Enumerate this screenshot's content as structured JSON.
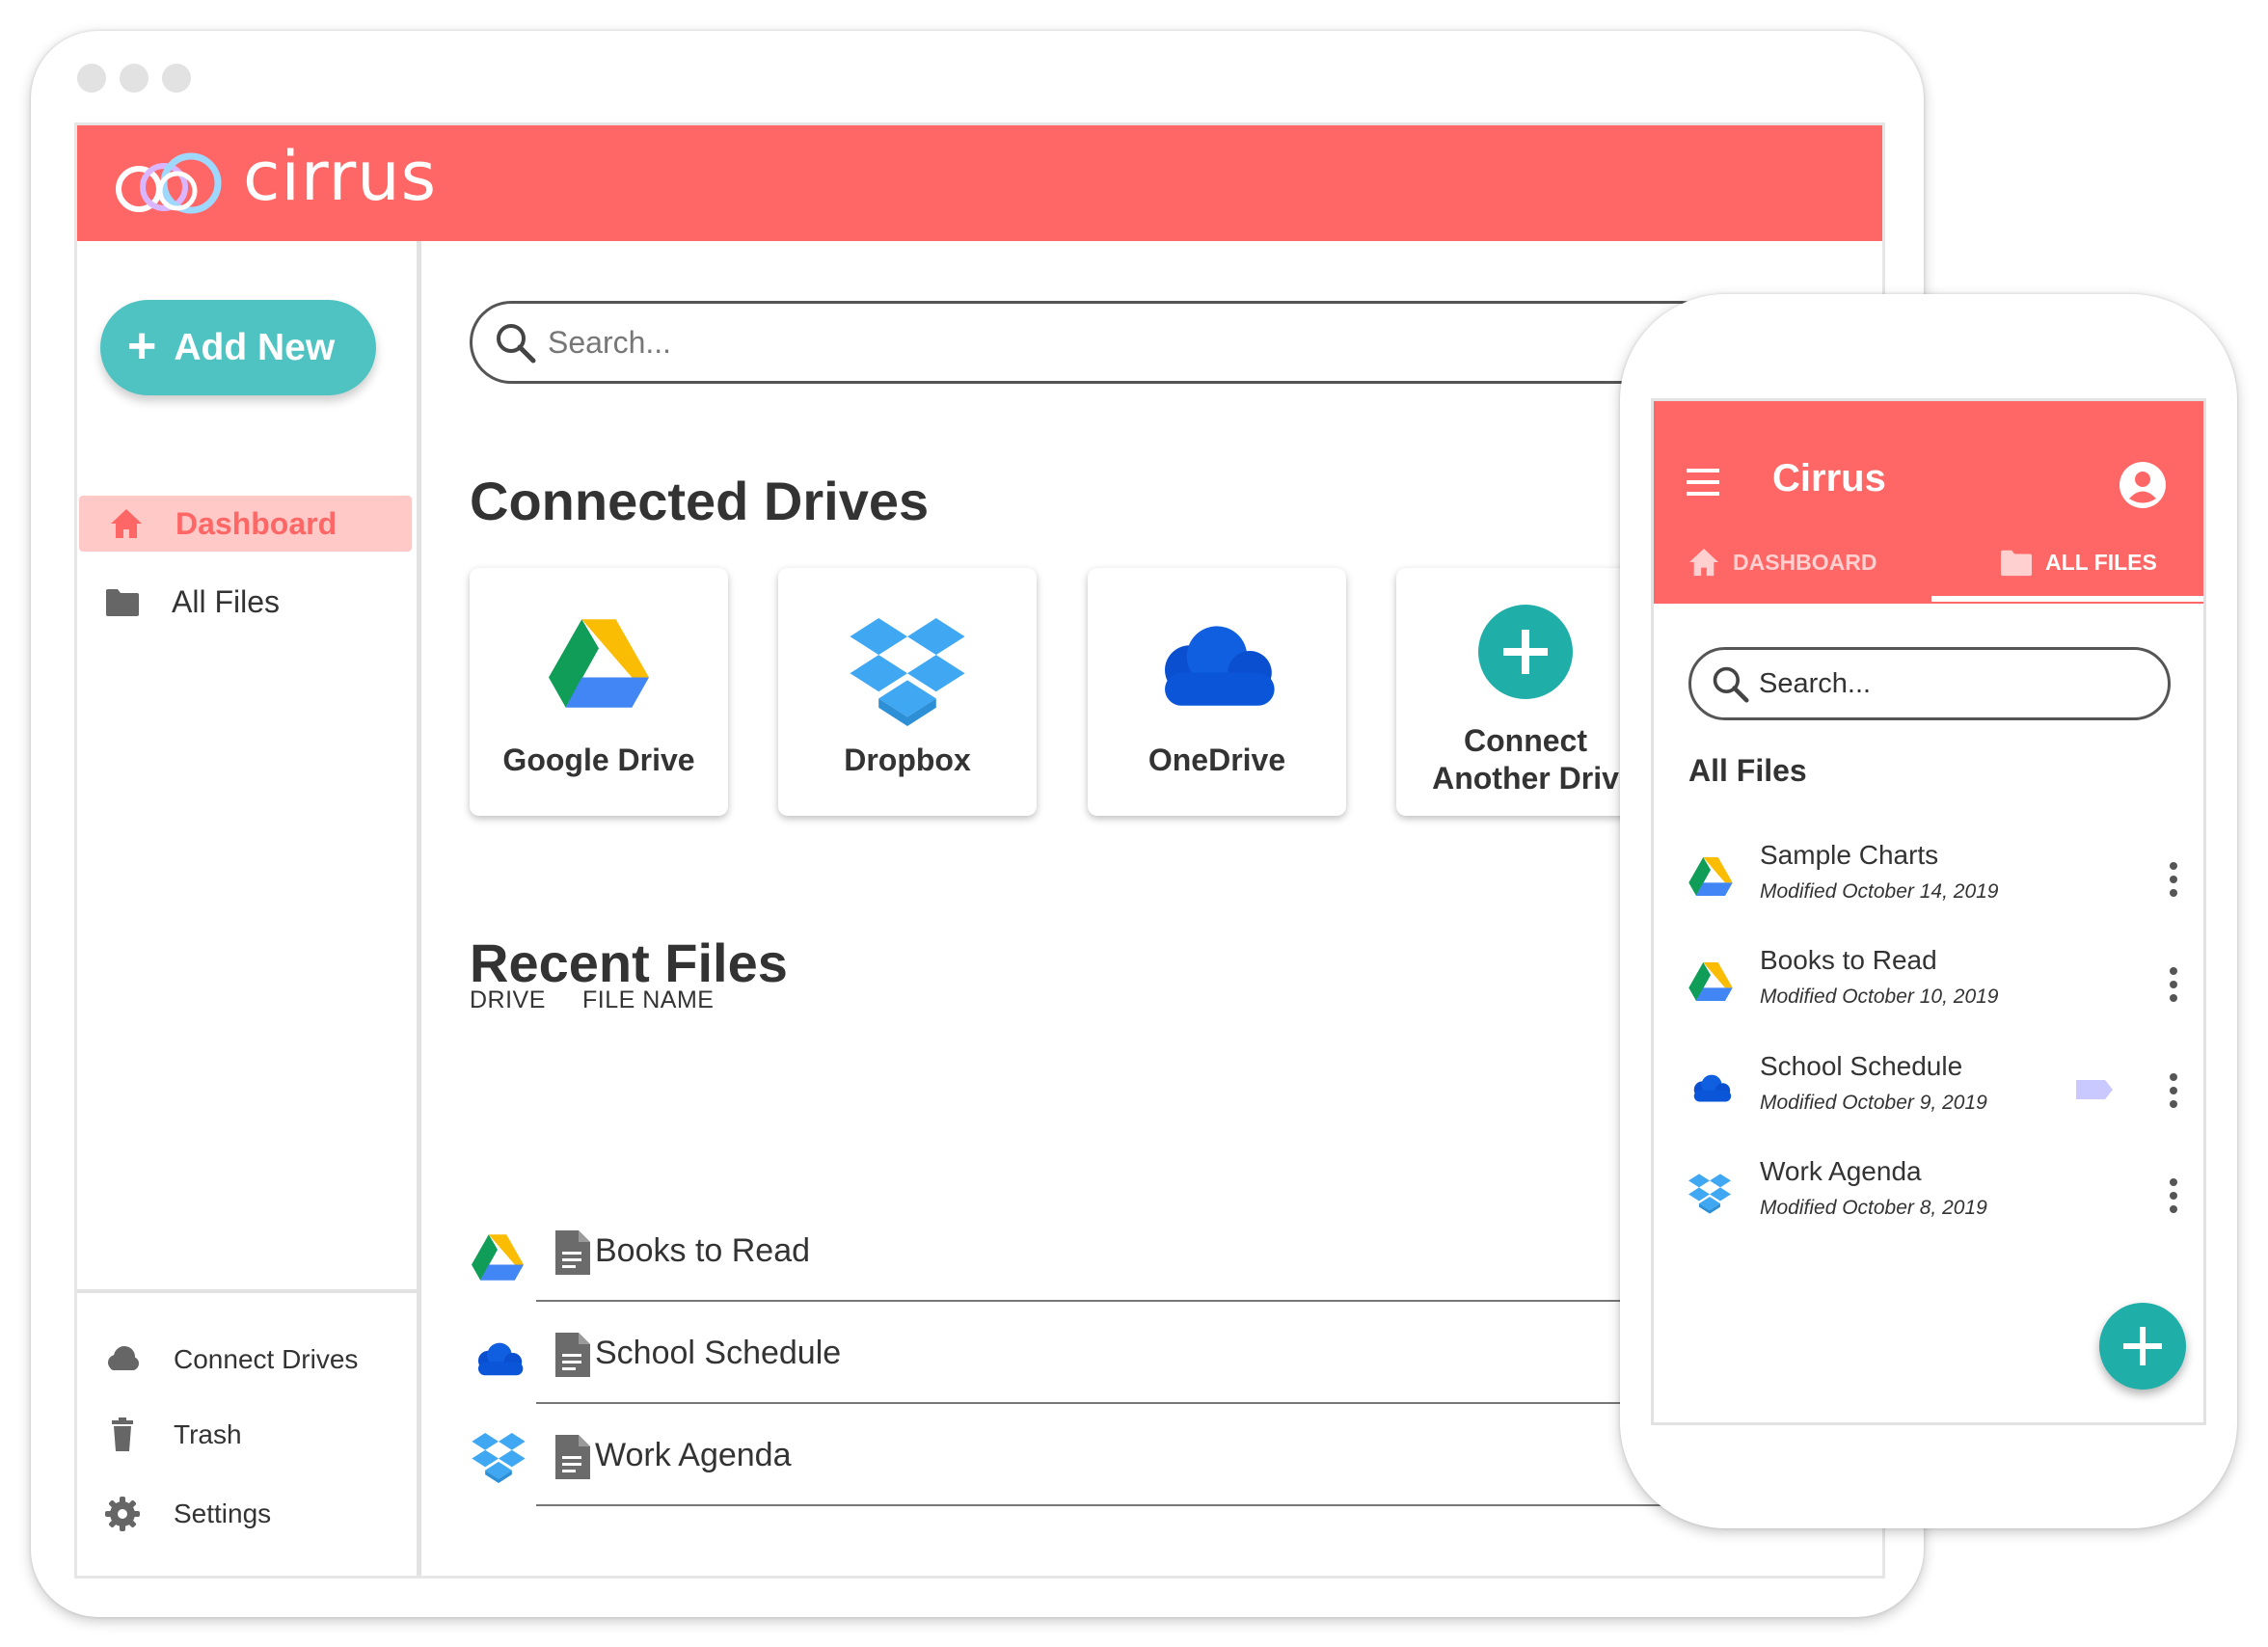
{
  "app": {
    "brand": "cirrus",
    "mobile_title": "Cirrus"
  },
  "colors": {
    "primary": "#ff6766",
    "accent": "#4fc3c1",
    "fab": "#1fafa8",
    "active_bg": "#ffc9c8"
  },
  "sidebar": {
    "add_new_label": "Add New",
    "items": [
      {
        "label": "Dashboard",
        "icon": "home-icon",
        "active": true
      },
      {
        "label": "All Files",
        "icon": "folder-icon",
        "active": false
      }
    ],
    "footer": [
      {
        "label": "Connect Drives",
        "icon": "cloud-icon"
      },
      {
        "label": "Trash",
        "icon": "trash-icon"
      },
      {
        "label": "Settings",
        "icon": "gear-icon"
      }
    ]
  },
  "main": {
    "search_placeholder": "Search...",
    "connected_title": "Connected Drives",
    "drives": [
      {
        "label": "Google Drive",
        "icon": "google-drive-icon"
      },
      {
        "label": "Dropbox",
        "icon": "dropbox-icon"
      },
      {
        "label": "OneDrive",
        "icon": "onedrive-icon"
      },
      {
        "label_line1": "Connect",
        "label_line2": "Another Driv",
        "icon": "plus-icon"
      }
    ],
    "recent_title": "Recent Files",
    "columns": {
      "drive": "DRIVE",
      "file_name": "FILE NAME"
    },
    "recent_files": [
      {
        "drive": "google-drive-icon",
        "name": "Books to Read"
      },
      {
        "drive": "onedrive-icon",
        "name": "School Schedule"
      },
      {
        "drive": "dropbox-icon",
        "name": "Work Agenda"
      }
    ]
  },
  "mobile": {
    "tabs": [
      {
        "label": "DASHBOARD",
        "icon": "home-icon",
        "active": false
      },
      {
        "label": "ALL FILES",
        "icon": "folder-icon",
        "active": true
      }
    ],
    "search_placeholder": "Search...",
    "heading": "All Files",
    "files": [
      {
        "drive": "google-drive-icon",
        "name": "Sample Charts",
        "modified": "Modified October 14, 2019"
      },
      {
        "drive": "google-drive-icon",
        "name": "Books to Read",
        "modified": "Modified October 10, 2019"
      },
      {
        "drive": "onedrive-icon",
        "name": "School Schedule",
        "modified": "Modified October 9, 2019",
        "tag": "label-icon"
      },
      {
        "drive": "dropbox-icon",
        "name": "Work Agenda",
        "modified": "Modified October 8, 2019"
      }
    ]
  }
}
